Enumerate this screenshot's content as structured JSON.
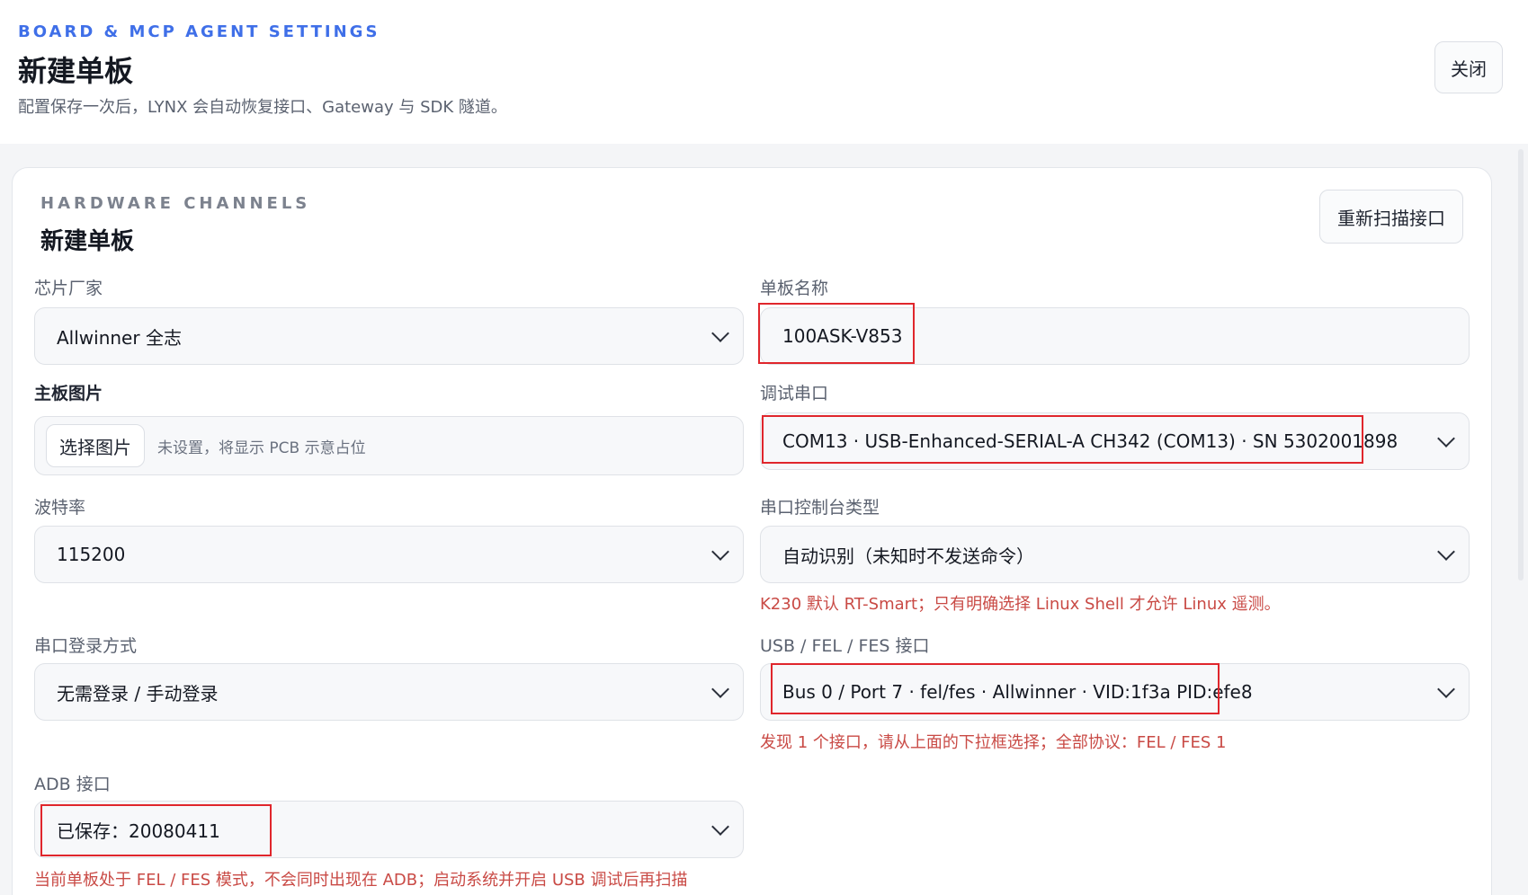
{
  "header": {
    "eyebrow": "BOARD & MCP AGENT SETTINGS",
    "title": "新建单板",
    "subtitle": "配置保存一次后，LYNX 会自动恢复接口、Gateway 与 SDK 隧道。",
    "close_label": "关闭"
  },
  "section": {
    "eyebrow": "HARDWARE CHANNELS",
    "title": "新建单板",
    "rescan_label": "重新扫描接口"
  },
  "fields": {
    "vendor": {
      "label": "芯片厂家",
      "value": "Allwinner 全志"
    },
    "board_name": {
      "label": "单板名称",
      "value": "100ASK-V853"
    },
    "board_image": {
      "label": "主板图片",
      "button_label": "选择图片",
      "hint": "未设置，将显示 PCB 示意占位"
    },
    "debug_serial": {
      "label": "调试串口",
      "value": "COM13 · USB-Enhanced-SERIAL-A CH342 (COM13) · SN 5302001898"
    },
    "baud_rate": {
      "label": "波特率",
      "value": "115200"
    },
    "console_type": {
      "label": "串口控制台类型",
      "value": "自动识别（未知时不发送命令）",
      "hint": "K230 默认 RT-Smart；只有明确选择 Linux Shell 才允许 Linux 遥测。"
    },
    "login_method": {
      "label": "串口登录方式",
      "value": "无需登录 / 手动登录"
    },
    "usb_port": {
      "label": "USB / FEL / FES 接口",
      "value": "Bus 0 / Port 7 · fel/fes · Allwinner · VID:1f3a PID:efe8",
      "hint": "发现 1 个接口，请从上面的下拉框选择；全部协议：FEL / FES 1"
    },
    "adb_port": {
      "label": "ADB 接口",
      "value": "已保存：20080411",
      "hint": "当前单板处于 FEL / FES 模式，不会同时出现在 ADB；启动系统并开启 USB 调试后再扫描"
    }
  },
  "colors": {
    "accent": "#3f6fe8",
    "warning": "#c94a45",
    "highlight": "#e0262c"
  }
}
